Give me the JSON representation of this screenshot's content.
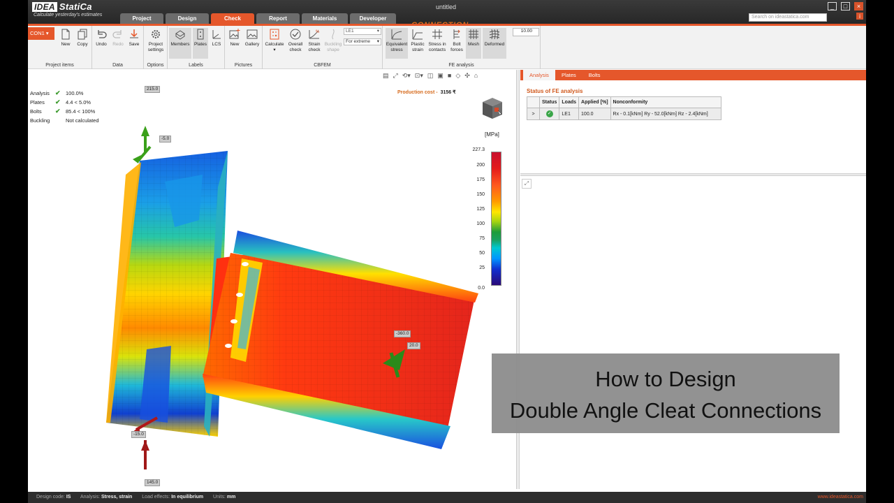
{
  "app": {
    "brand": "IDEA",
    "brand2": "StatiCa",
    "product": "CONNECTION",
    "tagline": "Calculate yesterday's estimates",
    "window_title": "untitled",
    "search_placeholder": "Search on ideastatica.com",
    "window_buttons": {
      "minimize": "_",
      "maximize": "□",
      "close": "×",
      "info": "i"
    }
  },
  "tabs": [
    "Project",
    "Design",
    "Check",
    "Report",
    "Materials",
    "Developer"
  ],
  "active_tab": "Check",
  "ribbon": {
    "project_items": {
      "label": "Project items",
      "con": "CON1",
      "new": "New",
      "copy": "Copy"
    },
    "data": {
      "label": "Data",
      "undo": "Undo",
      "redo": "Redo",
      "save": "Save"
    },
    "options": {
      "label": "Options",
      "settings": "Project settings"
    },
    "labels": {
      "label": "Labels",
      "members": "Members",
      "plates": "Plates",
      "lcs": "LCS"
    },
    "pictures": {
      "label": "Pictures",
      "new": "New",
      "gallery": "Gallery"
    },
    "cbfem": {
      "label": "CBFEM",
      "calculate": "Calculate",
      "overall": "Overall check",
      "strain": "Strain check",
      "buckling": "Buckling shape",
      "le_select": "LE1",
      "extreme_select": "For extreme"
    },
    "fe": {
      "label": "FE analysis",
      "eq_stress": "Equivalent stress",
      "plastic": "Plastic strain",
      "stress_contacts": "Stress in contacts",
      "bolt_forces": "Bolt forces",
      "mesh": "Mesh",
      "deformed": "Deformed",
      "scale": "10.00"
    }
  },
  "results": [
    {
      "label": "Analysis",
      "check": "✔",
      "value": "100.0%"
    },
    {
      "label": "Plates",
      "check": "✔",
      "value": "4.4 < 5.0%"
    },
    {
      "label": "Bolts",
      "check": "✔",
      "value": "85.4 < 100%"
    },
    {
      "label": "Buckling",
      "check": "",
      "value": "Not calculated"
    }
  ],
  "production_cost": {
    "label": "Production cost",
    "value": "3156 ₹"
  },
  "legend": {
    "unit": "[MPa]",
    "values": [
      "227.3",
      "200",
      "175",
      "150",
      "125",
      "100",
      "75",
      "50",
      "25",
      "0.0"
    ]
  },
  "force_labels": {
    "top": "215.0",
    "top2": "-5.0",
    "beam1": "-360.0",
    "beam2": "20.0",
    "bottom1": "-15.0",
    "bottom2": "145.0"
  },
  "right_panel": {
    "tabs": [
      "Analysis",
      "Plates",
      "Bolts"
    ],
    "title": "Status of FE analysis",
    "columns": [
      "Status",
      "Loads",
      "Applied [%]",
      "Nonconformity"
    ],
    "row": {
      "expand": ">",
      "loads": "LE1",
      "applied": "100.0",
      "nonconformity": "Rx - 0.1[kNm]  Ry - 52.0[kNm]  Rz - 2.4[kNm]"
    }
  },
  "statusbar": {
    "design_code_label": "Design code:",
    "design_code": "IS",
    "analysis_label": "Analysis:",
    "analysis": "Stress, strain",
    "load_label": "Load effects:",
    "load": "In equilibrium",
    "units_label": "Units:",
    "units": "mm",
    "site": "www.ideastatica.com"
  },
  "overlay": {
    "line1": "How to Design",
    "line2": "Double Angle Cleat Connections"
  },
  "colors": {
    "accent": "#e5572b",
    "ok": "#3aa548"
  }
}
